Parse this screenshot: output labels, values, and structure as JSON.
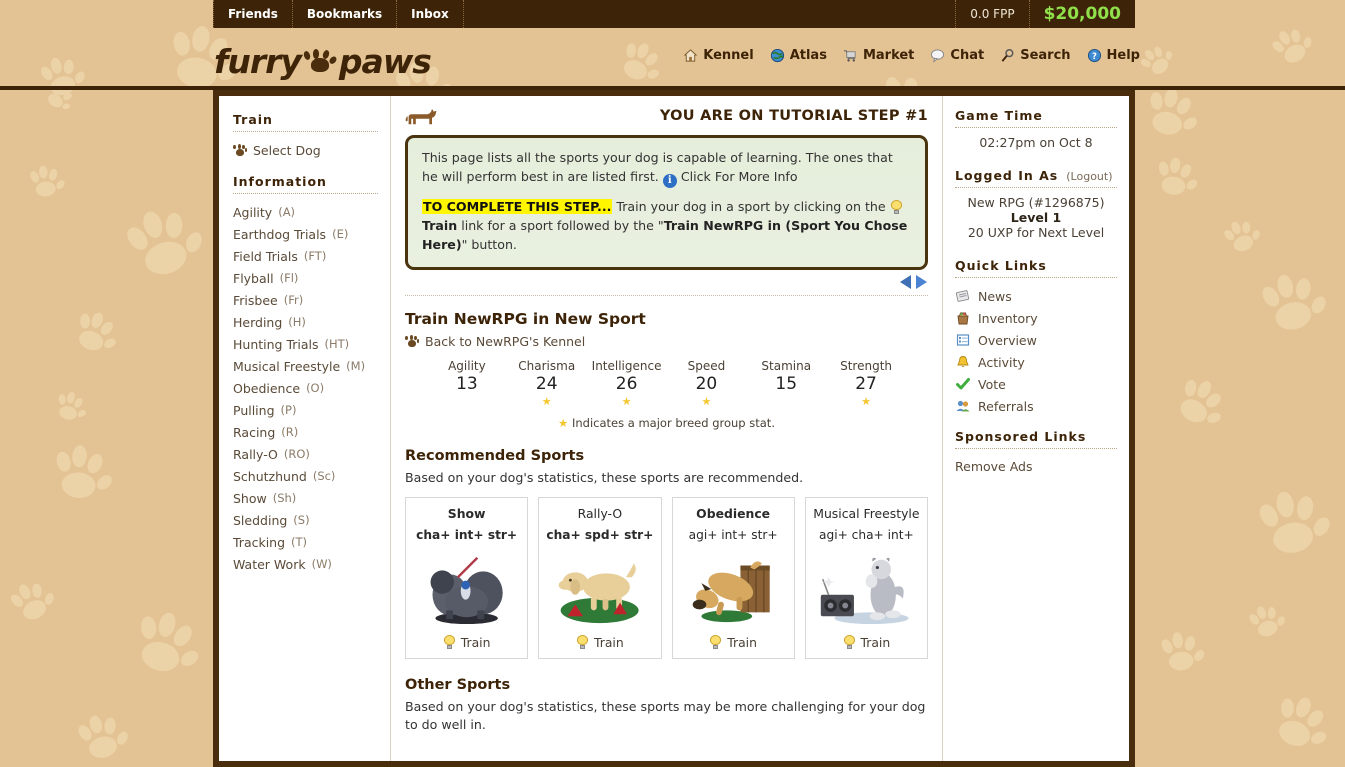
{
  "topbar": {
    "items": [
      {
        "label": "Friends"
      },
      {
        "label": "Bookmarks"
      },
      {
        "label": "Inbox"
      }
    ],
    "fpp": "0.0 FPP",
    "money": "$20,000",
    "money_color": "#8fe04a"
  },
  "header": {
    "logo_left": "furry",
    "logo_right": "paws",
    "nav": [
      {
        "label": "Kennel",
        "icon": "home-icon"
      },
      {
        "label": "Atlas",
        "icon": "globe-icon"
      },
      {
        "label": "Market",
        "icon": "cart-icon"
      },
      {
        "label": "Chat",
        "icon": "speech-bubble-icon"
      },
      {
        "label": "Search",
        "icon": "magnifier-icon"
      },
      {
        "label": "Help",
        "icon": "question-icon"
      }
    ]
  },
  "sidebar": {
    "train_heading": "Train",
    "select_dog": "Select Dog",
    "information_heading": "Information",
    "sports": [
      {
        "name": "Agility",
        "abbr": "(A)"
      },
      {
        "name": "Earthdog Trials",
        "abbr": "(E)"
      },
      {
        "name": "Field Trials",
        "abbr": "(FT)"
      },
      {
        "name": "Flyball",
        "abbr": "(Fl)"
      },
      {
        "name": "Frisbee",
        "abbr": "(Fr)"
      },
      {
        "name": "Herding",
        "abbr": "(H)"
      },
      {
        "name": "Hunting Trials",
        "abbr": "(HT)"
      },
      {
        "name": "Musical Freestyle",
        "abbr": "(M)"
      },
      {
        "name": "Obedience",
        "abbr": "(O)"
      },
      {
        "name": "Pulling",
        "abbr": "(P)"
      },
      {
        "name": "Racing",
        "abbr": "(R)"
      },
      {
        "name": "Rally-O",
        "abbr": "(RO)"
      },
      {
        "name": "Schutzhund",
        "abbr": "(Sc)"
      },
      {
        "name": "Show",
        "abbr": "(Sh)"
      },
      {
        "name": "Sledding",
        "abbr": "(S)"
      },
      {
        "name": "Tracking",
        "abbr": "(T)"
      },
      {
        "name": "Water Work",
        "abbr": "(W)"
      }
    ]
  },
  "tutorial": {
    "title": "YOU ARE ON TUTORIAL STEP #1",
    "para1_a": "This page lists all the sports your dog is capable of learning. The ones that he will perform best in are listed first.",
    "more_info": "Click For More Info",
    "highlight": "TO COMPLETE THIS STEP...",
    "para2_a": " Train your dog in a sport by clicking on the ",
    "train_word": "Train",
    "para2_b": " link for a sport followed by the \"",
    "button_quote": "Train NewRPG in (Sport You Chose Here)",
    "para2_c": "\" button."
  },
  "main": {
    "page_title": "Train NewRPG in New Sport",
    "back_link": "Back to NewRPG's Kennel",
    "stats": [
      {
        "label": "Agility",
        "value": "13",
        "star": false
      },
      {
        "label": "Charisma",
        "value": "24",
        "star": true
      },
      {
        "label": "Intelligence",
        "value": "26",
        "star": true
      },
      {
        "label": "Speed",
        "value": "20",
        "star": true
      },
      {
        "label": "Stamina",
        "value": "15",
        "star": false
      },
      {
        "label": "Strength",
        "value": "27",
        "star": true
      }
    ],
    "star_note": "Indicates a major breed group stat.",
    "recommended_heading": "Recommended Sports",
    "recommended_desc": "Based on your dog's statistics, these sports are recommended.",
    "train_label": "Train",
    "cards": [
      {
        "name": "Show",
        "bold_name": true,
        "stats": "cha+ int+ str+",
        "bold_stats": true,
        "art": "show-dog-art"
      },
      {
        "name": "Rally-O",
        "bold_name": false,
        "stats": "cha+ spd+ str+",
        "bold_stats": true,
        "art": "rally-o-dog-art"
      },
      {
        "name": "Obedience",
        "bold_name": true,
        "stats": "agi+ int+ str+",
        "bold_stats": false,
        "art": "obedience-dog-art"
      },
      {
        "name": "Musical Freestyle",
        "bold_name": false,
        "stats": "agi+ cha+ int+",
        "bold_stats": false,
        "art": "musical-freestyle-dog-art"
      }
    ],
    "other_heading": "Other Sports",
    "other_desc": "Based on your dog's statistics, these sports may be more challenging for your dog to do well in."
  },
  "rightbar": {
    "game_time_heading": "Game Time",
    "game_time": "02:27pm on Oct 8",
    "logged_in_heading": "Logged In As",
    "logout": "(Logout)",
    "username": "New RPG (#1296875)",
    "level": "Level 1",
    "uxp": "20 UXP for Next Level",
    "quick_links_heading": "Quick Links",
    "quick_links": [
      {
        "label": "News",
        "icon": "newspaper-icon"
      },
      {
        "label": "Inventory",
        "icon": "bag-icon"
      },
      {
        "label": "Overview",
        "icon": "list-icon"
      },
      {
        "label": "Activity",
        "icon": "bell-icon"
      },
      {
        "label": "Vote",
        "icon": "checkmark-icon"
      },
      {
        "label": "Referrals",
        "icon": "people-icon"
      }
    ],
    "sponsored_heading": "Sponsored Links",
    "remove_ads": "Remove Ads"
  }
}
